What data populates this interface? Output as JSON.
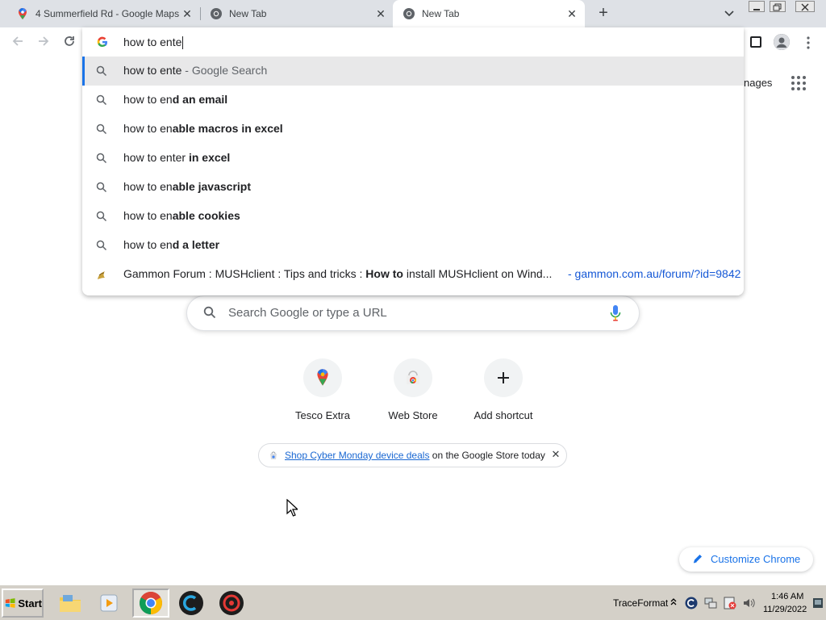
{
  "tabs": [
    {
      "title": "4 Summerfield Rd - Google Maps",
      "icon": "google-maps-pin-icon",
      "active": false
    },
    {
      "title": "New Tab",
      "icon": "chrome-icon",
      "active": false
    },
    {
      "title": "New Tab",
      "icon": "chrome-icon",
      "active": true
    }
  ],
  "tabstrip": {
    "new_tab": "+",
    "close": "✕",
    "tab_search": "⌄"
  },
  "omnibox": {
    "value": "how to ente",
    "logo": "G"
  },
  "suggestions": [
    {
      "prefix": "how to ente",
      "bold": "",
      "suffix": " - Google Search",
      "selected": true
    },
    {
      "prefix": "how to en",
      "bold": "d an email",
      "suffix": "",
      "selected": false
    },
    {
      "prefix": "how to en",
      "bold": "able macros in excel",
      "suffix": "",
      "selected": false
    },
    {
      "prefix": "how to enter",
      "bold": " in excel",
      "suffix": "",
      "selected": false
    },
    {
      "prefix": "how to en",
      "bold": "able javascript",
      "suffix": "",
      "selected": false
    },
    {
      "prefix": "how to en",
      "bold": "able cookies",
      "suffix": "",
      "selected": false
    },
    {
      "prefix": "how to en",
      "bold": "d a letter",
      "suffix": "",
      "selected": false
    }
  ],
  "history_suggestion": {
    "pre": "Gammon Forum : MUSHclient : Tips and tricks : ",
    "bold": "How to",
    "post": " install MUSHclient on Wind...",
    "url": "- gammon.com.au/forum/?id=9842"
  },
  "page": {
    "images_link": "nages",
    "search_placeholder": "Search Google or type a URL",
    "shortcuts": [
      {
        "label": "Tesco Extra",
        "icon": "google-maps-pin-icon"
      },
      {
        "label": "Web Store",
        "icon": "chrome-web-store-icon"
      },
      {
        "label": "Add shortcut",
        "icon": "plus-icon"
      }
    ],
    "promo": {
      "link": "Shop Cyber Monday device deals",
      "rest": " on the Google Store today",
      "close": "✕"
    },
    "customize": "Customize Chrome"
  },
  "taskbar": {
    "start": "Start",
    "tray_label": "TraceFormat",
    "time": "1:46 AM",
    "date": "11/29/2022"
  },
  "colors": {
    "accent": "#1a73e8",
    "tab_strip": "#dee1e6",
    "taskbar": "#d4d0c8"
  }
}
